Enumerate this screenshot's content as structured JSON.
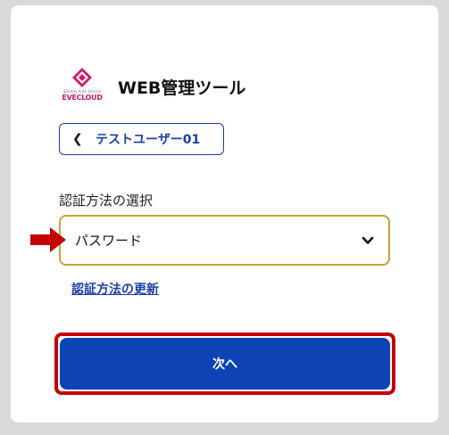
{
  "logo": {
    "tagline": "iDentity Auth Service",
    "brand": "EVECLOUD",
    "color": "#d01a6d"
  },
  "header": {
    "title": "WEB管理ツール"
  },
  "back": {
    "icon": "chevron-left-icon",
    "label": "テストユーザー01"
  },
  "auth_method": {
    "label": "認証方法の選択",
    "selected": "パスワード",
    "caret_icon": "chevron-down-icon"
  },
  "annotation": {
    "icon": "red-arrow-right-icon",
    "color": "#c40000"
  },
  "update_link": {
    "label": "認証方法の更新"
  },
  "next": {
    "label": "次へ",
    "color": "#0d43b5"
  }
}
